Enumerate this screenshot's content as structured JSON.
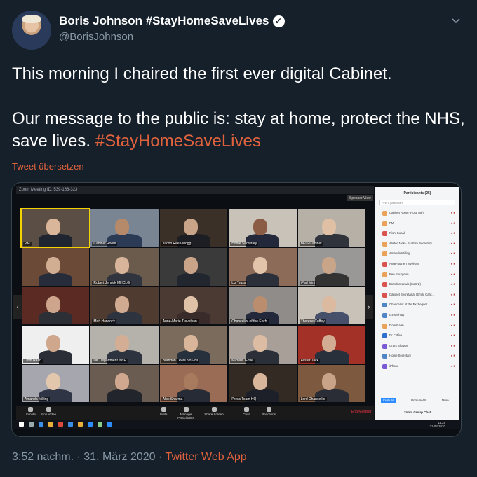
{
  "author": {
    "display_name": "Boris Johnson #StayHomeSaveLives",
    "handle": "@BorisJohnson",
    "verified_icon": "verified-badge-icon"
  },
  "tweet": {
    "line1": "This morning I chaired the first ever digital Cabinet.",
    "line2_prefix": "Our message to the public is: stay at home, protect the NHS, save lives. ",
    "hashtag": "#StayHomeSaveLives",
    "translate_label": "Tweet übersetzen"
  },
  "footer": {
    "time_date": "3:52 nachm. · 31. März 2020 · ",
    "source": "Twitter Web App"
  },
  "media": {
    "window_title": "Zoom Meeting ID: 539-166-323",
    "speaker_view": "Speaker View",
    "participants_title": "Participants (25)",
    "find_placeholder": "Find a participant",
    "tiles": [
      {
        "name": "PM",
        "face": "#d9b59a",
        "bg": "#5b4e44",
        "shirt": "#1f2530"
      },
      {
        "name": "Cabinet Room",
        "face": "#b48a6a",
        "bg": "#7a8594",
        "shirt": "#2b3b55"
      },
      {
        "name": "Jacob Rees-Mogg",
        "face": "#caa489",
        "bg": "#3b3028",
        "shirt": "#1d1d24"
      },
      {
        "name": "Home Secretary",
        "face": "#8a5c45",
        "bg": "#c9c2b8",
        "shirt": "#23283a"
      },
      {
        "name": "BEIS Cabinet",
        "face": "#e0c0a4",
        "bg": "#b7b0a6",
        "shirt": "#2f333b"
      },
      {
        "name": "",
        "face": "#d1ad92",
        "bg": "#6c4a38",
        "shirt": "#262c3a"
      },
      {
        "name": "Robert Jenrick MHCLG",
        "face": "#d7b49a",
        "bg": "#6b5b4c",
        "shirt": "#30343e"
      },
      {
        "name": "",
        "face": "#caa489",
        "bg": "#3a3a3a",
        "shirt": "#22262e"
      },
      {
        "name": "Liz Truss",
        "face": "#e2c4ab",
        "bg": "#8c6b58",
        "shirt": "#2a2f3a"
      },
      {
        "name": "iPad Mini",
        "face": "#c8a488",
        "bg": "#9a9896",
        "shirt": "#333"
      },
      {
        "name": "",
        "face": "#cda58c",
        "bg": "#5b2a22",
        "shirt": "#2c2f36"
      },
      {
        "name": "Matt Hancock",
        "face": "#d0ab92",
        "bg": "#4f3b30",
        "shirt": "#2d3440"
      },
      {
        "name": "Anne-Marie Trevelyan",
        "face": "#e0c2a8",
        "bg": "#4a3a33",
        "shirt": "#3a2b2b"
      },
      {
        "name": "Chancellor of the Exch",
        "face": "#b98d6e",
        "bg": "#8f8c8a",
        "shirt": "#23283a"
      },
      {
        "name": "Therese Coffey",
        "face": "#dcbaa0",
        "bg": "#c9c2b8",
        "shirt": "#47506a"
      },
      {
        "name": "Dom Raab",
        "face": "#cfa78d",
        "bg": "#efefef",
        "shirt": "#2b2e36"
      },
      {
        "name": "UK Department for E",
        "face": "#d3ae94",
        "bg": "#b5b1ab",
        "shirt": "#2d3440"
      },
      {
        "name": "Brandon Lewis SoS NI",
        "face": "#d9b59a",
        "bg": "#7b6b5c",
        "shirt": "#27303d"
      },
      {
        "name": "Michael Gove",
        "face": "#dcbca2",
        "bg": "#a8a098",
        "shirt": "#2a2f38"
      },
      {
        "name": "Alister Jack",
        "face": "#d2ad93",
        "bg": "#a33128",
        "shirt": "#28303c"
      },
      {
        "name": "Amanda Milling",
        "face": "#e3c7ad",
        "bg": "#a6a7ae",
        "shirt": "#2f3545"
      },
      {
        "name": "",
        "face": "#cfa88f",
        "bg": "#6b5c52",
        "shirt": "#22252c"
      },
      {
        "name": "Alok Sharma",
        "face": "#a87a5e",
        "bg": "#9a6b55",
        "shirt": "#262b35"
      },
      {
        "name": "Press Team HQ",
        "face": "#d8b69c",
        "bg": "#332a24",
        "shirt": "#1d2028"
      },
      {
        "name": "Lord Chancellor",
        "face": "#c9a387",
        "bg": "#7d5a3f",
        "shirt": "#2a2d35"
      }
    ],
    "participants": [
      {
        "name": "Cabinet Room (Host, me)",
        "color": "#e9a35b"
      },
      {
        "name": "PM",
        "color": "#e9a35b"
      },
      {
        "name": "Rishi Sunak",
        "color": "#d9534f"
      },
      {
        "name": "Alister Jack - Scottish Secretary",
        "color": "#e9a35b"
      },
      {
        "name": "Amanda Milling",
        "color": "#e9a35b"
      },
      {
        "name": "Anne-Marie Trevelyan",
        "color": "#d9534f"
      },
      {
        "name": "Ben Spurgeon",
        "color": "#e9a35b"
      },
      {
        "name": "Brandon Lewis (SoSNI)",
        "color": "#d9534f"
      },
      {
        "name": "Cabinet Secretariat (Emily Card...",
        "color": "#d9534f"
      },
      {
        "name": "Chancellor of the Exchequer",
        "color": "#4f86c6"
      },
      {
        "name": "chris whitty",
        "color": "#4f86c6"
      },
      {
        "name": "Dom Raab",
        "color": "#e9a35b"
      },
      {
        "name": "Dr Coffee",
        "color": "#2f6fd0"
      },
      {
        "name": "Grant Shapps",
        "color": "#7b5ad6"
      },
      {
        "name": "Home Secretary",
        "color": "#4f86c6"
      },
      {
        "name": "iPhone",
        "color": "#7b5ad6"
      }
    ],
    "panel_footer": {
      "invite": "Invite All",
      "unmute": "Unmute All",
      "more": "More"
    },
    "group_chat": "Zoom Group Chat",
    "controls": [
      {
        "label": "Unmute"
      },
      {
        "label": "Stop Video"
      },
      {
        "label": "Invite"
      },
      {
        "label": "Manage Participants"
      },
      {
        "label": "Share Screen"
      },
      {
        "label": "Chat"
      },
      {
        "label": "Reactions"
      }
    ],
    "end_meeting": "End Meeting",
    "tray_time": "11:28",
    "tray_date": "31/03/2020"
  }
}
